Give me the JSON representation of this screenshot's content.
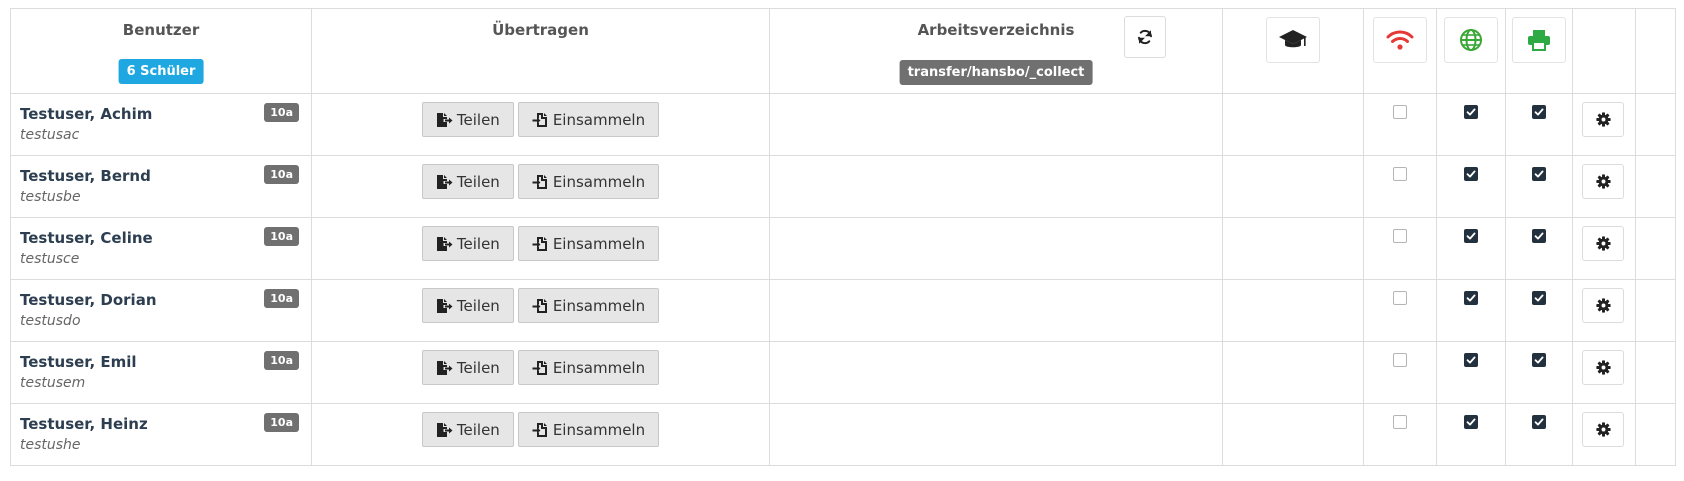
{
  "header": {
    "users_title": "Benutzer",
    "students_badge": "6 Schüler",
    "transfer_title": "Übertragen",
    "workdir_title": "Arbeitsverzeichnis",
    "workdir_path": "transfer/hansbo/_collect",
    "icons": [
      "refresh-icon",
      "graduation-cap-icon",
      "wifi-icon",
      "globe-icon",
      "printer-icon"
    ],
    "colors": {
      "wifi": "#e53935",
      "globe": "#3aa635",
      "printer": "#2eaa44",
      "students_badge": "#1fa7e1"
    }
  },
  "actions": {
    "share_label": "Teilen",
    "collect_label": "Einsammeln"
  },
  "users": [
    {
      "name": "Testuser, Achim",
      "login": "testusac",
      "class": "10a",
      "wifi": false,
      "internet": true,
      "printing": true
    },
    {
      "name": "Testuser, Bernd",
      "login": "testusbe",
      "class": "10a",
      "wifi": false,
      "internet": true,
      "printing": true
    },
    {
      "name": "Testuser, Celine",
      "login": "testusce",
      "class": "10a",
      "wifi": false,
      "internet": true,
      "printing": true
    },
    {
      "name": "Testuser, Dorian",
      "login": "testusdo",
      "class": "10a",
      "wifi": false,
      "internet": true,
      "printing": true
    },
    {
      "name": "Testuser, Emil",
      "login": "testusem",
      "class": "10a",
      "wifi": false,
      "internet": true,
      "printing": true
    },
    {
      "name": "Testuser, Heinz",
      "login": "testushe",
      "class": "10a",
      "wifi": false,
      "internet": true,
      "printing": true
    }
  ]
}
